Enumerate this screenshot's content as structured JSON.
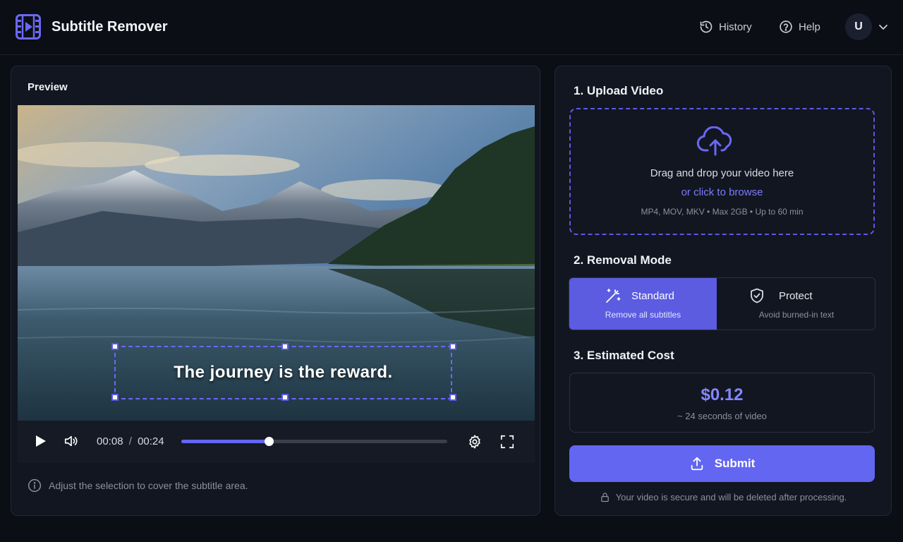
{
  "header": {
    "app_title": "Subtitle Remover",
    "history_label": "History",
    "help_label": "Help",
    "avatar_initial": "U"
  },
  "preview": {
    "title": "Preview",
    "subtitle_text": "The journey is the reward.",
    "current_time": "00:08",
    "time_separator": "/",
    "total_time": "00:24",
    "progress_fraction": 0.33,
    "hint": "Adjust the selection to cover the subtitle area."
  },
  "upload": {
    "title": "1. Upload Video",
    "main_text": "Drag and drop your video here",
    "browse_link": "or click to browse",
    "formats": "MP4, MOV, MKV • Max 2GB • Up to 60 min"
  },
  "mode": {
    "title": "2. Removal Mode",
    "options": [
      {
        "label": "Standard",
        "desc": "Remove all subtitles",
        "active": true,
        "icon": "magic-wand-icon"
      },
      {
        "label": "Protect",
        "desc": "Avoid burned-in text",
        "active": false,
        "icon": "shield-icon"
      }
    ]
  },
  "cost": {
    "title": "3. Estimated Cost",
    "value": "$0.12",
    "sub": "~ 24 seconds of video"
  },
  "submit": {
    "label": "Submit",
    "secure_note": "Your video is secure and will be deleted after processing."
  },
  "colors": {
    "accent": "#6366f1",
    "background": "#0b0e14",
    "panel": "#121620"
  }
}
